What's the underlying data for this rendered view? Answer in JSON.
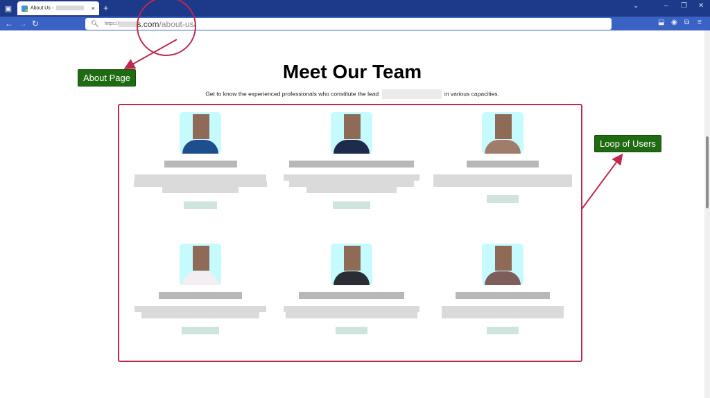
{
  "browser": {
    "tab": {
      "title": "About Us - ",
      "favicon": "site-favicon",
      "close": "×"
    },
    "new_tab": "+",
    "tab_list": "▾",
    "window_controls": {
      "list": "⌄",
      "minimize": "–",
      "restore": "❐",
      "close": "✕"
    },
    "nav": {
      "back": "←",
      "forward": "→",
      "reload": "↻"
    },
    "url": {
      "scheme": "https://",
      "domain_suffix": "s.com",
      "path": "/about-us/"
    },
    "toolbar_icons": {
      "pocket": "⬓",
      "profile": "◉",
      "extensions": "⧉",
      "menu": "≡"
    }
  },
  "page": {
    "heading": "Meet Our Team",
    "subtitle_before": "Get to know the experienced professionals who constitute the lead",
    "subtitle_after": "in various capacities.",
    "members": [
      {
        "photo_bg": "#c5fbff",
        "attire": "#1d4f8f"
      },
      {
        "photo_bg": "#c5fbff",
        "attire": "#1e2b4a"
      },
      {
        "photo_bg": "#c5fbff",
        "attire": "#a07d6b"
      },
      {
        "photo_bg": "#c5fbff",
        "attire": "#f3eef2"
      },
      {
        "photo_bg": "#c5fbff",
        "attire": "#2a2d33"
      },
      {
        "photo_bg": "#c5fbff",
        "attire": "#7e5e5b"
      }
    ]
  },
  "annotations": {
    "about_page": "About Page",
    "loop_of_users": "Loop of Users",
    "color": "#c0284e",
    "label_bg": "#1f6b12"
  }
}
